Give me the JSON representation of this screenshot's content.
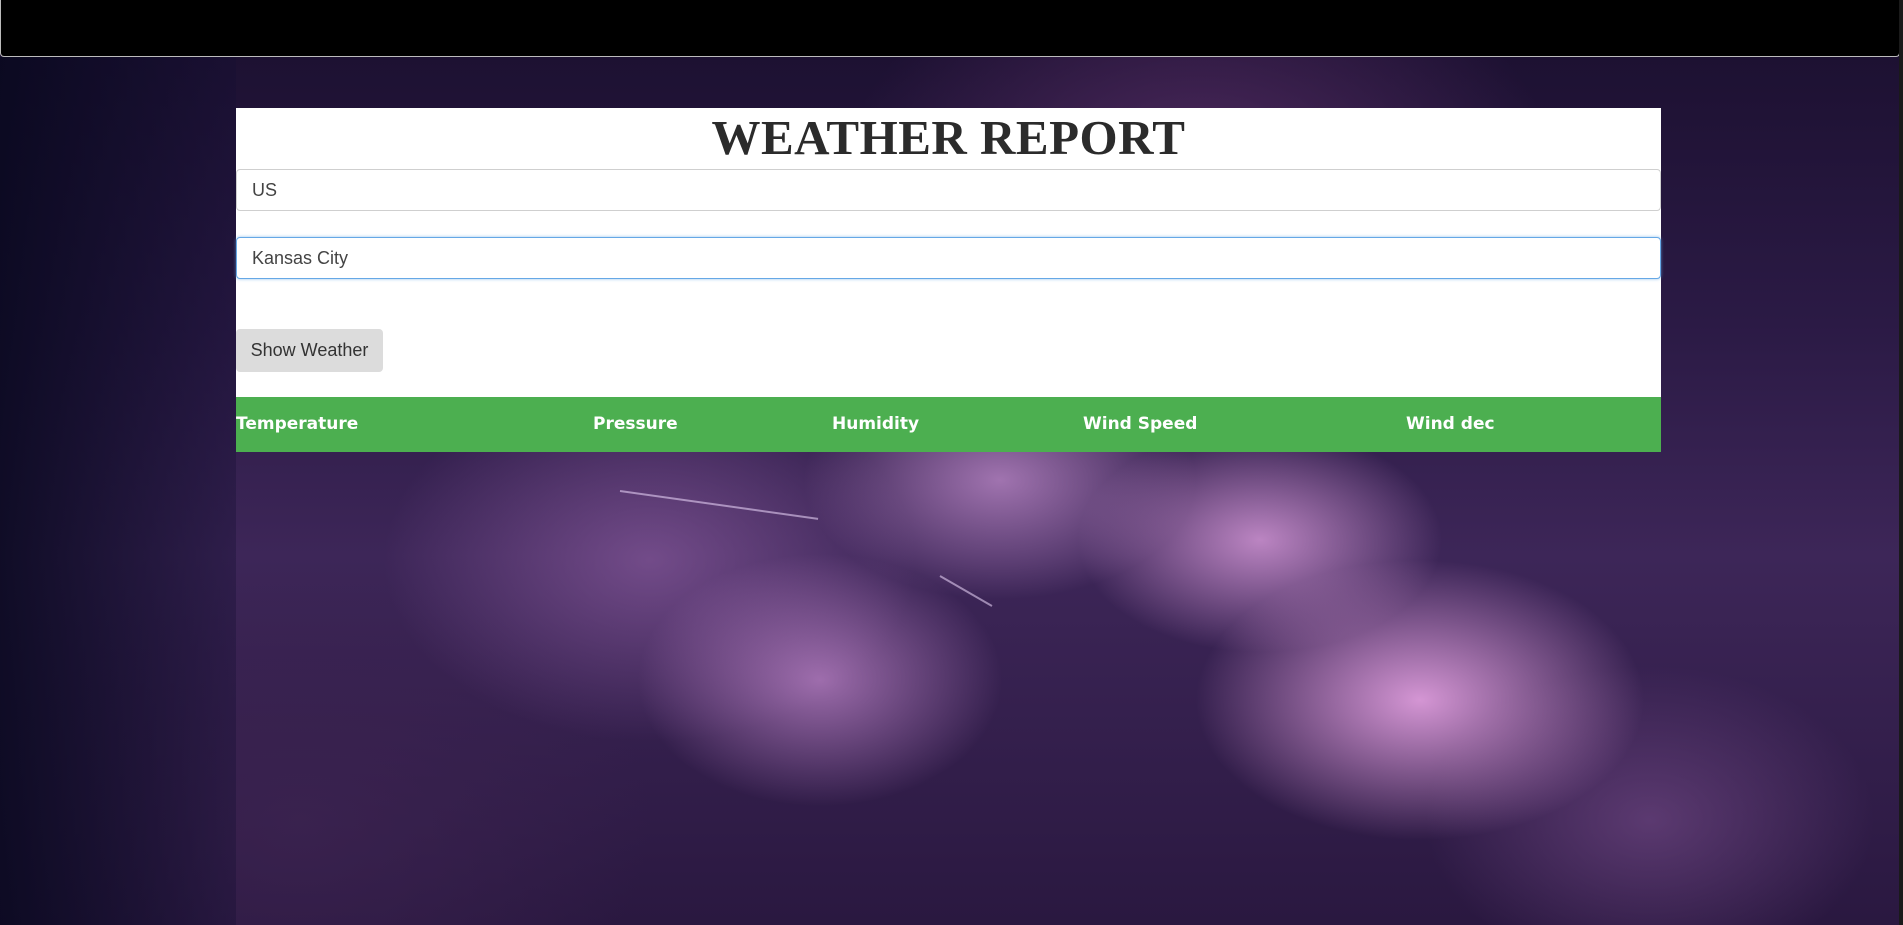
{
  "header": {
    "title": "WEATHER REPORT"
  },
  "form": {
    "country_value": "US",
    "city_value": "Kansas City",
    "show_button_label": "Show Weather"
  },
  "results": {
    "columns": [
      "Temperature",
      "Pressure",
      "Humidity",
      "Wind Speed",
      "Wind dec"
    ]
  },
  "colors": {
    "topbar": "#000000",
    "panel_background": "#ffffff",
    "results_header": "#4caf50",
    "button_background": "#dcdcdc",
    "focused_input_border": "#66a8e6"
  }
}
